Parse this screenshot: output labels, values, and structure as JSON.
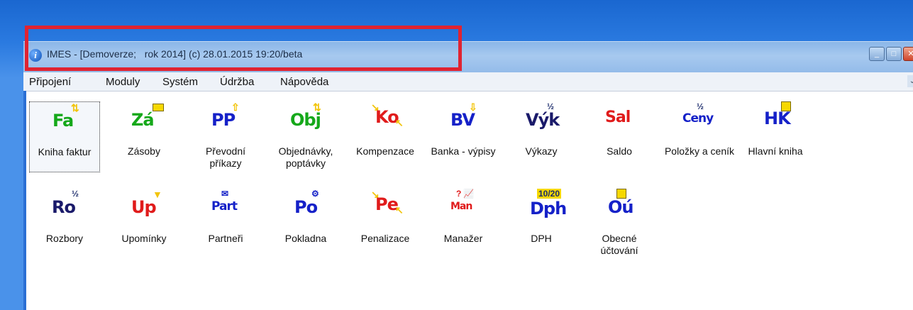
{
  "window": {
    "title": "IMES - [Demoverze;   rok 2014] (c) 28.01.2015 19:20/beta",
    "icon": "info-icon"
  },
  "menu": [
    {
      "label": "Připojení"
    },
    {
      "label": "Moduly"
    },
    {
      "label": "Systém"
    },
    {
      "label": "Údržba"
    },
    {
      "label": "Nápověda"
    }
  ],
  "tiles": [
    {
      "glyph": "Fa",
      "label": "Kniha faktur",
      "color": "#15a81a",
      "icon": "invoice-book-icon"
    },
    {
      "glyph": "Zá",
      "label": "Zásoby",
      "color": "#15a81a",
      "icon": "stock-icon"
    },
    {
      "glyph": "PP",
      "label": "Převodní příkazy",
      "color": "#1521c8",
      "icon": "transfer-orders-icon"
    },
    {
      "glyph": "Obj",
      "label": "Objednávky, poptávky",
      "color": "#15a81a",
      "icon": "orders-icon"
    },
    {
      "glyph": "Ko",
      "label": "Kompenzace",
      "color": "#e01b1b",
      "icon": "compensation-icon"
    },
    {
      "glyph": "BV",
      "label": "Banka - výpisy",
      "color": "#1521c8",
      "icon": "bank-statements-icon"
    },
    {
      "glyph": "Výk",
      "label": "Výkazy",
      "color": "#1a1a6a",
      "icon": "reports-icon"
    },
    {
      "glyph": "Sal",
      "label": "Saldo",
      "color": "#e01b1b",
      "icon": "balance-icon"
    },
    {
      "glyph": "Ceny",
      "label": "Položky a ceník",
      "color": "#1521c8",
      "icon": "price-list-icon"
    },
    {
      "glyph": "HK",
      "label": "Hlavní kniha",
      "color": "#1521c8",
      "icon": "general-ledger-icon"
    },
    {
      "glyph": "Ro",
      "label": "Rozbory",
      "color": "#1a1a6a",
      "icon": "analysis-icon"
    },
    {
      "glyph": "Up",
      "label": "Upomínky",
      "color": "#e01b1b",
      "icon": "reminders-icon"
    },
    {
      "glyph": "Part",
      "label": "Partneři",
      "color": "#1521c8",
      "icon": "partners-icon"
    },
    {
      "glyph": "Po",
      "label": "Pokladna",
      "color": "#1521c8",
      "icon": "cash-register-icon"
    },
    {
      "glyph": "Pe",
      "label": "Penalizace",
      "color": "#e01b1b",
      "icon": "penalties-icon"
    },
    {
      "glyph": "Man",
      "label": "Manažer",
      "color": "#e01b1b",
      "icon": "manager-icon"
    },
    {
      "glyph": "Dph",
      "label": "DPH",
      "color": "#1521c8",
      "icon": "vat-icon"
    },
    {
      "glyph": "Oú",
      "label": "Obecné účtování",
      "color": "#1521c8",
      "icon": "general-accounting-icon"
    }
  ]
}
